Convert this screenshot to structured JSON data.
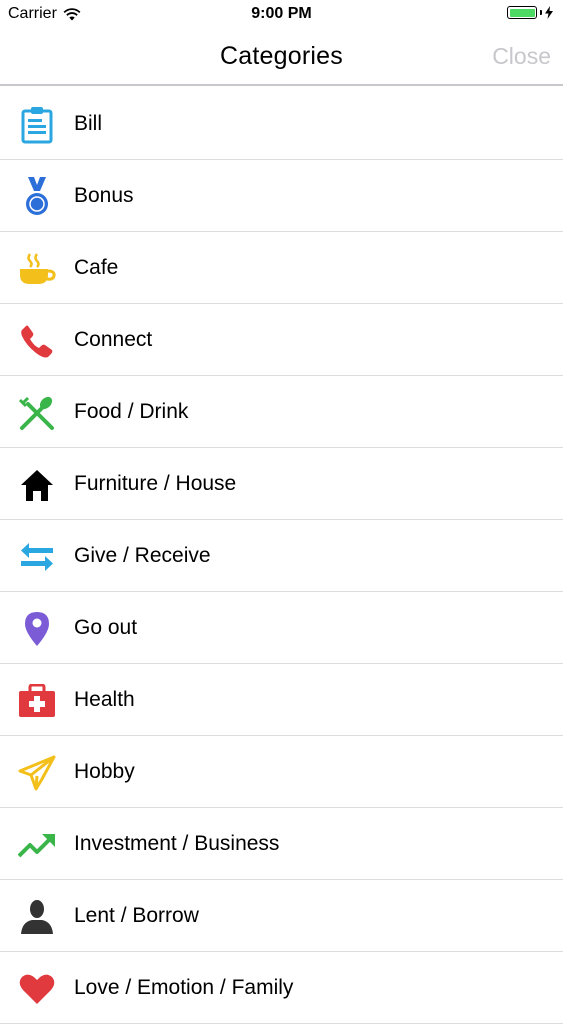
{
  "status_bar": {
    "carrier": "Carrier",
    "time": "9:00 PM"
  },
  "nav": {
    "title": "Categories",
    "close_label": "Close"
  },
  "categories": [
    {
      "label": "Bill",
      "icon": "clipboard-icon",
      "color": "#2aa6e0"
    },
    {
      "label": "Bonus",
      "icon": "medal-icon",
      "color": "#2d6fd8"
    },
    {
      "label": "Cafe",
      "icon": "coffee-cup-icon",
      "color": "#f3c01b"
    },
    {
      "label": "Connect",
      "icon": "phone-icon",
      "color": "#e0393e"
    },
    {
      "label": "Food / Drink",
      "icon": "fork-spoon-icon",
      "color": "#39b54a"
    },
    {
      "label": "Furniture / House",
      "icon": "house-icon",
      "color": "#000000"
    },
    {
      "label": "Give / Receive",
      "icon": "exchange-arrows-icon",
      "color": "#2aa6e0"
    },
    {
      "label": "Go out",
      "icon": "location-pin-icon",
      "color": "#7b5bd6"
    },
    {
      "label": "Health",
      "icon": "first-aid-kit-icon",
      "color": "#e0393e"
    },
    {
      "label": "Hobby",
      "icon": "paper-plane-icon",
      "color": "#f3c01b"
    },
    {
      "label": "Investment / Business",
      "icon": "trending-up-icon",
      "color": "#39b54a"
    },
    {
      "label": "Lent / Borrow",
      "icon": "person-icon",
      "color": "#333333"
    },
    {
      "label": "Love / Emotion / Family",
      "icon": "heart-icon",
      "color": "#e0393e"
    }
  ]
}
